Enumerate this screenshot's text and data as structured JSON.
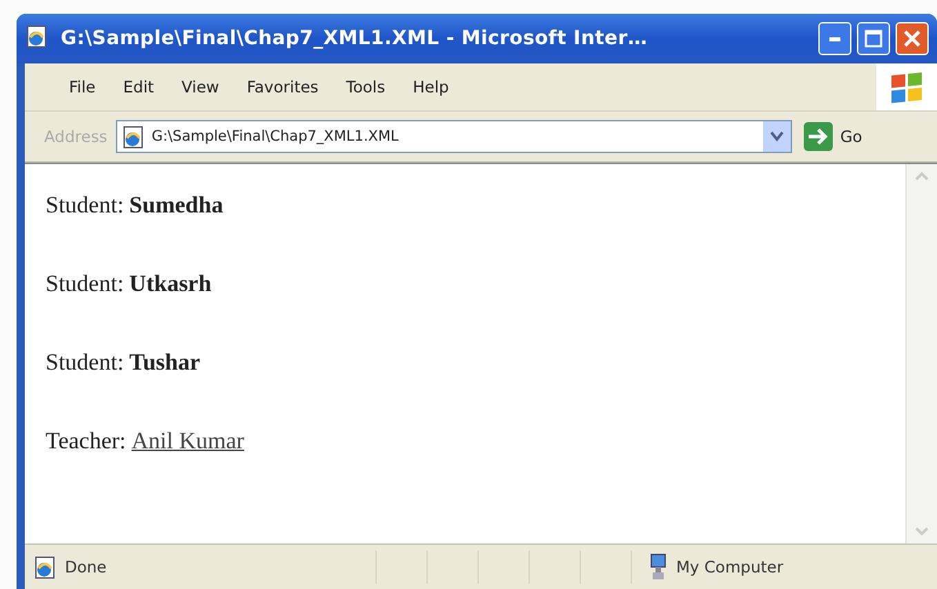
{
  "window": {
    "title": "G:\\Sample\\Final\\Chap7_XML1.XML - Microsoft Inter…"
  },
  "menu": [
    "File",
    "Edit",
    "View",
    "Favorites",
    "Tools",
    "Help"
  ],
  "address_bar": {
    "label": "Address",
    "value": "G:\\Sample\\Final\\Chap7_XML1.XML",
    "go": "Go"
  },
  "entries": [
    {
      "kind": "student",
      "label": "Student:",
      "name": "Sumedha"
    },
    {
      "kind": "student",
      "label": "Student:",
      "name": "Utkasrh"
    },
    {
      "kind": "student",
      "label": "Student:",
      "name": "Tushar"
    },
    {
      "kind": "teacher",
      "label": "Teacher:",
      "name": "Anil Kumar"
    }
  ],
  "status_bar": {
    "status": "Done",
    "zone": "My Computer"
  }
}
